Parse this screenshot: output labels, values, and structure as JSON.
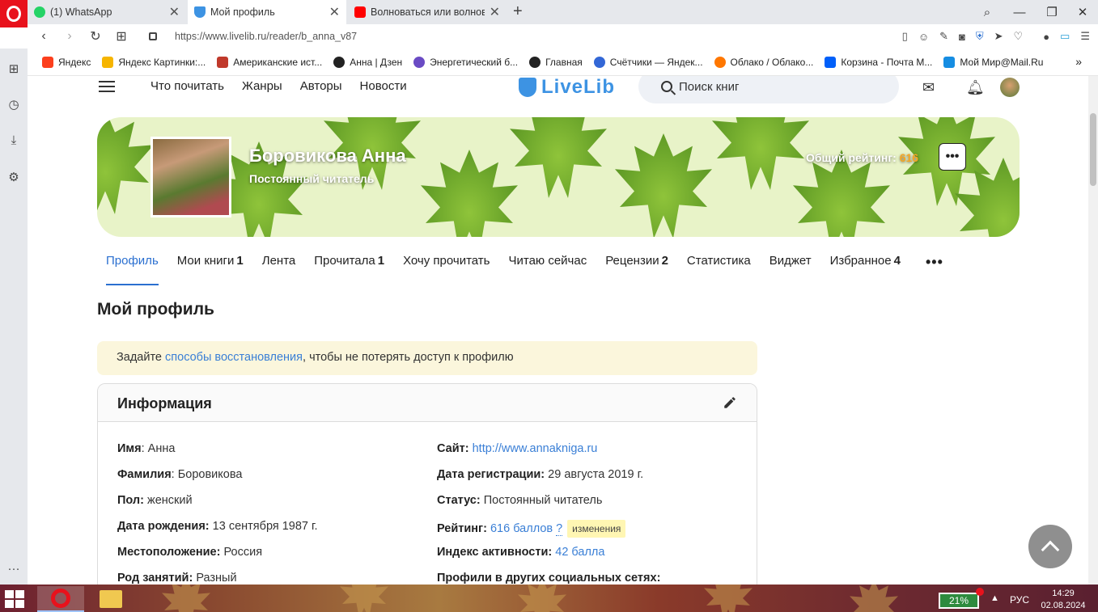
{
  "browser": {
    "tabs": [
      {
        "title": "(1) WhatsApp",
        "icon": "whatsapp-icon",
        "color": "#25d366"
      },
      {
        "title": "Мой профиль",
        "icon": "livelib-icon",
        "color": "#3d93e3"
      },
      {
        "title": "Волноваться или волнова",
        "icon": "youtube-icon",
        "color": "#ff0000"
      }
    ],
    "url": "https://www.livelib.ru/reader/b_anna_v87"
  },
  "bookmarks": [
    {
      "label": "Яндекс",
      "color": "#fc3f1d"
    },
    {
      "label": "Яндекс Картинки:...",
      "color": "#f6b500"
    },
    {
      "label": "Американские ист...",
      "color": "#c0392b"
    },
    {
      "label": "Анна | Дзен",
      "color": "#222222"
    },
    {
      "label": "Энергетический б...",
      "color": "#6a4bc4"
    },
    {
      "label": "Главная",
      "color": "#222222"
    },
    {
      "label": "Счётчики — Яндек...",
      "color": "#3367d6"
    },
    {
      "label": "Облако / Облако...",
      "color": "#ff7700"
    },
    {
      "label": "Корзина - Почта М...",
      "color": "#005ff9"
    },
    {
      "label": "Мой Мир@Mail.Ru",
      "color": "#168de2"
    }
  ],
  "site": {
    "nav": [
      "Что почитать",
      "Жанры",
      "Авторы",
      "Новости"
    ],
    "logo": "LiveLib",
    "search_placeholder": "Поиск книг"
  },
  "profile": {
    "name": "Боровикова Анна",
    "status": "Постоянный читатель",
    "rating_label": "Общий рейтинг:",
    "rating_value": "616",
    "tabs": [
      {
        "label": "Профиль",
        "count": ""
      },
      {
        "label": "Мои книги",
        "count": "1"
      },
      {
        "label": "Лента",
        "count": ""
      },
      {
        "label": "Прочитала",
        "count": "1"
      },
      {
        "label": "Хочу прочитать",
        "count": ""
      },
      {
        "label": "Читаю сейчас",
        "count": ""
      },
      {
        "label": "Рецензии",
        "count": "2"
      },
      {
        "label": "Статистика",
        "count": ""
      },
      {
        "label": "Виджет",
        "count": ""
      },
      {
        "label": "Избранное",
        "count": "4"
      }
    ],
    "page_title": "Мой профиль"
  },
  "notice": {
    "before": "Задайте ",
    "link": "способы восстановления",
    "after": ", чтобы не потерять доступ к профилю"
  },
  "info": {
    "title": "Информация",
    "left": [
      {
        "label": "Имя",
        "value": "Анна"
      },
      {
        "label": "Фамилия",
        "value": "Боровикова"
      },
      {
        "label": "Пол",
        "value": "женский"
      },
      {
        "label": "Дата рождения",
        "value": "13 сентября 1987 г."
      },
      {
        "label": "Местоположение",
        "value": "Россия"
      },
      {
        "label": "Род занятий",
        "value": "Разный"
      }
    ],
    "site_label": "Сайт",
    "site_value": "http://www.annakniga.ru",
    "reg_label": "Дата регистрации",
    "reg_value": "29 августа 2019 г.",
    "status_label": "Статус",
    "status_value": "Постоянный читатель",
    "rating_label": "Рейтинг",
    "rating_value": "616 баллов",
    "rating_q": "?",
    "rating_chip": "изменения",
    "activity_label": "Индекс активности",
    "activity_value": "42 балла",
    "social_label": "Профили в других социальных сетях"
  },
  "taskbar": {
    "battery": "21%",
    "lang": "РУС",
    "time": "14:29",
    "date": "02.08.2024"
  }
}
